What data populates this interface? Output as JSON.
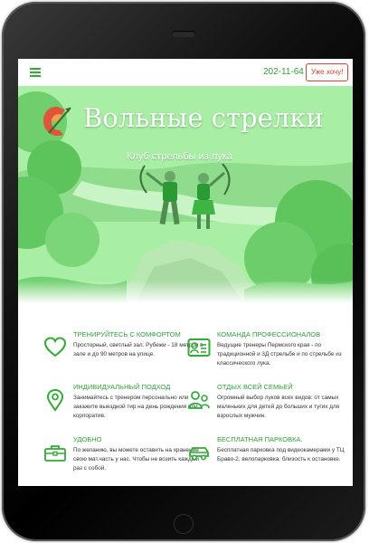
{
  "header": {
    "phone": "202-11-64",
    "cta_label": "Уже хочу!"
  },
  "hero": {
    "title": "Вольные стрелки",
    "subtitle": "Клуб стрельбы из лука"
  },
  "features": [
    {
      "icon": "heart-icon",
      "title": "ТРЕНИРУЙТЕСЬ С КОМФОРТОМ",
      "text": "Просторный, светлый зал. Рубежи - 18 метров в зале и до 90 метров на улице."
    },
    {
      "icon": "id-card-icon",
      "title": "КОМАНДА ПРОФЕССИОНАЛОВ",
      "text": "Ведущие тренеры Пермского края - по традиционной и 3Д стрельбе и по стрельбе из классического лука."
    },
    {
      "icon": "location-pin-icon",
      "title": "ИНДИВИДУАЛЬНЫЙ ПОДХОД",
      "text": "Занимайтесь с тренером персонально или закажите выездной тир на день рождения или корпоратив."
    },
    {
      "icon": "family-icon",
      "title": "ОТДЫХ ВСЕЙ СЕМЬЕЙ",
      "text": "Огромный выбор луков всех видов: от самых маленьких для детей до больших и тугих для взрослых мужчин."
    },
    {
      "icon": "toolbox-icon",
      "title": "УДОБНО",
      "text": "По желанию, вы можете оставить на хранение свою мат.часть у нас. Чтобы не возить каждый раз с собой."
    },
    {
      "icon": "car-icon",
      "title": "БЕСПЛАТНАЯ ПАРКОВКА.",
      "text": "Бесплатная парковка под видеокамерами у ТЦ Браво-2, велопарковка. близость к остановке."
    }
  ],
  "colors": {
    "accent_green": "#2fae34",
    "cta_red": "#e0402e",
    "hero_tint": "#9be99a"
  }
}
